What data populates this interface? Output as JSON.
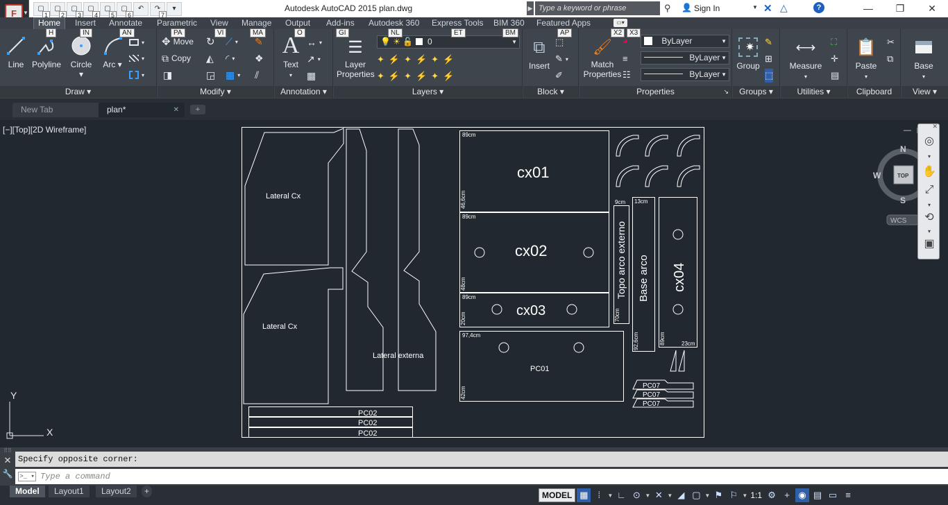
{
  "window": {
    "title": "Autodesk AutoCAD 2015    plan.dwg",
    "app_button_letter": "F",
    "minimize_symbol": "—",
    "restore_symbol": "❐",
    "close_symbol": "✕"
  },
  "quick_access": {
    "buttons": [
      {
        "icon": "new-icon",
        "glyph": "▢",
        "badge": "1"
      },
      {
        "icon": "open-icon",
        "glyph": "▢",
        "badge": "2"
      },
      {
        "icon": "save-icon",
        "glyph": "▢",
        "badge": "3"
      },
      {
        "icon": "save-as-icon",
        "glyph": "▢",
        "badge": "4"
      },
      {
        "icon": "web-mobile-icon",
        "glyph": "▢",
        "badge": "5"
      },
      {
        "icon": "plot-icon",
        "glyph": "▢",
        "badge": "6"
      },
      {
        "icon": "undo-icon",
        "glyph": "↶",
        "badge": ""
      },
      {
        "icon": "redo-icon",
        "glyph": "↷",
        "badge": "7"
      },
      {
        "icon": "customize-icon",
        "glyph": "▾",
        "badge": ""
      }
    ]
  },
  "search": {
    "placeholder": "Type a keyword or phrase",
    "arrow": "▶"
  },
  "account": {
    "sign_in": "Sign In",
    "exchange_glyph": "✕",
    "autodesk360_glyph": "△",
    "help_glyph": "?"
  },
  "ribbon_tabs": [
    {
      "label": "Home",
      "key": "H",
      "active": true
    },
    {
      "label": "Insert",
      "key": "IN",
      "active": false
    },
    {
      "label": "Annotate",
      "key": "AN",
      "active": false
    },
    {
      "label": "Parametric",
      "key": "PA",
      "active": false
    },
    {
      "label": "View",
      "key": "VI",
      "active": false
    },
    {
      "label": "Manage",
      "key": "MA",
      "active": false
    },
    {
      "label": "Output",
      "key": "O",
      "active": false
    },
    {
      "label": "Add-ins",
      "key": "GI",
      "active": false
    },
    {
      "label": "Autodesk 360",
      "key": "NL",
      "active": false
    },
    {
      "label": "Express Tools",
      "key": "ET",
      "active": false
    },
    {
      "label": "BIM 360",
      "key": "BM",
      "active": false
    },
    {
      "label": "Featured Apps",
      "key": "AP",
      "active": false
    }
  ],
  "extra_keytips": [
    "X2",
    "X3"
  ],
  "ribbon": {
    "draw": {
      "title": "Draw ▾",
      "line": "Line",
      "polyline": "Polyline",
      "circle": "Circle ▾",
      "arc": "Arc ▾"
    },
    "modify": {
      "title": "Modify ▾",
      "move": "Move",
      "copy": "Copy"
    },
    "annotation": {
      "title": "Annotation ▾",
      "text": "Text",
      "text_dd": "▾"
    },
    "layers": {
      "title": "Layers ▾",
      "layer_properties": "Layer Properties",
      "current_layer": "0"
    },
    "block": {
      "title": "Block ▾",
      "insert": "Insert"
    },
    "properties": {
      "title": "Properties",
      "match_properties": "Match Properties",
      "color": "ByLayer",
      "linetype": "ByLayer",
      "lineweight": "ByLayer",
      "launcher": "↘"
    },
    "groups": {
      "title": "Groups ▾",
      "group": "Group"
    },
    "utilities": {
      "title": "Utilities ▾",
      "measure": "Measure"
    },
    "clipboard": {
      "title": "Clipboard",
      "paste": "Paste"
    },
    "view": {
      "title": "View ▾",
      "base": "Base"
    }
  },
  "doc_tabs": [
    {
      "label": "New Tab",
      "active": false
    },
    {
      "label": "plan*",
      "active": true
    }
  ],
  "doc_tab_close": "✕",
  "doc_tab_new": "+",
  "viewport": {
    "label": "[−][Top][2D Wireframe]",
    "controls": [
      "—",
      "❐",
      "✕"
    ]
  },
  "viewcube": {
    "north": "N",
    "south": "S",
    "east": "E",
    "west": "W",
    "face": "TOP",
    "ucs": "WCS"
  },
  "ucs_icon": {
    "x": "X",
    "y": "Y"
  },
  "drawing_labels": {
    "lateral_cx_top": "Lateral Cx",
    "lateral_cx_bottom": "Lateral Cx",
    "lateral_externa": "Lateral externa",
    "cx01": "cx01",
    "cx02": "cx02",
    "cx03": "cx03",
    "cx04": "cx04",
    "pc01": "PC01",
    "pc02": [
      "PC02",
      "PC02",
      "PC02"
    ],
    "pc07": [
      "PC07",
      "PC07",
      "PC07"
    ],
    "topo_arco": "Topo arco externo",
    "base_arco": "Base arco",
    "dims": {
      "cx01_w": "89cm",
      "cx01_h": "46,6cm",
      "cx02_w": "89cm",
      "cx02_h": "48cm",
      "cx03_w": "89cm",
      "cx03_h": "20cm",
      "pc01_w": "97,4cm",
      "pc01_h": "42cm",
      "topo_w": "9cm",
      "topo_h": "70cm",
      "base_w": "13cm",
      "base_h": "92,6cm",
      "cx04_w": "23cm",
      "cx04_h": "89cm"
    }
  },
  "command_line": {
    "history": "Specify opposite corner:",
    "placeholder": "Type a command",
    "prompt_glyph": ">_ ▾",
    "close_glyph": "✕",
    "settings_glyph": "🔧"
  },
  "layout_tabs": [
    {
      "label": "Model",
      "active": true
    },
    {
      "label": "Layout1",
      "active": false
    },
    {
      "label": "Layout2",
      "active": false
    }
  ],
  "layout_add": "+",
  "status_bar": {
    "model": "MODEL",
    "annotation_scale": "1:1",
    "items": [
      {
        "name": "grid-icon",
        "glyph": "▦",
        "on": true
      },
      {
        "name": "snap-icon",
        "glyph": "⁞",
        "on": false
      },
      {
        "name": "ortho-icon",
        "glyph": "∟",
        "on": false
      },
      {
        "name": "polar-icon",
        "glyph": "⊙",
        "on": false
      },
      {
        "name": "osnap-icon",
        "glyph": "✕",
        "on": false
      },
      {
        "name": "lineweight-icon",
        "glyph": "◢",
        "on": false
      },
      {
        "name": "transparency-icon",
        "glyph": "▢",
        "on": false
      },
      {
        "name": "annotation-visibility-icon",
        "glyph": "⚑",
        "on": false
      },
      {
        "name": "autoscale-icon",
        "glyph": "⚐",
        "on": false
      },
      {
        "name": "workspace-icon",
        "glyph": "⚙",
        "on": false
      },
      {
        "name": "add-icon",
        "glyph": "+",
        "on": false
      },
      {
        "name": "isolate-icon",
        "glyph": "◉",
        "on": true
      },
      {
        "name": "hardware-accel-icon",
        "glyph": "▤",
        "on": false
      },
      {
        "name": "clean-screen-icon",
        "glyph": "▭",
        "on": false
      },
      {
        "name": "customize-icon",
        "glyph": "≡",
        "on": false
      }
    ]
  }
}
